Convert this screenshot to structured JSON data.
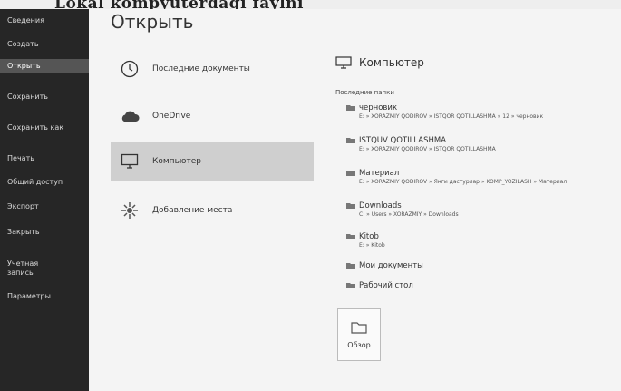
{
  "photo_caption": "Lokal kompyuterdagi faylni",
  "sidebar": {
    "items": [
      {
        "label": "Сведения"
      },
      {
        "label": "Создать"
      },
      {
        "label": "Открыть"
      },
      {
        "label": "Сохранить"
      },
      {
        "label": "Сохранить как"
      },
      {
        "label": "Печать"
      },
      {
        "label": "Общий доступ"
      },
      {
        "label": "Экспорт"
      },
      {
        "label": "Закрыть"
      },
      {
        "label": "Учетная запись"
      },
      {
        "label": "Параметры"
      }
    ]
  },
  "main": {
    "title": "Открыть",
    "places": [
      {
        "label": "Последние документы",
        "icon": "clock-icon"
      },
      {
        "label": "OneDrive",
        "icon": "cloud-icon"
      },
      {
        "label": "Компьютер",
        "icon": "monitor-icon"
      },
      {
        "label": "Добавление места",
        "icon": "add-place-icon"
      }
    ]
  },
  "panel": {
    "title": "Компьютер",
    "recent_heading": "Последние папки",
    "folders": [
      {
        "name": "черновик",
        "path": "E: » XORAZMIY QODIROV » ISTQOR QOTILLASHMA » 12 » черновик"
      },
      {
        "name": "ISTQUV QOTILLASHMA",
        "path": "E: » XORAZMIY QODIROV » ISTQOR QOTILLASHMA"
      },
      {
        "name": "Материал",
        "path": "E: » XORAZMIY QODIROV » Янги дастурлар » KOMP_YOZILASH » Материал"
      },
      {
        "name": "Downloads",
        "path": "C: » Users » XORAZMIY » Downloads"
      },
      {
        "name": "Kitob",
        "path": "E: » Kitob"
      },
      {
        "name": "Мои документы",
        "path": ""
      },
      {
        "name": "Рабочий стол",
        "path": ""
      }
    ],
    "browse_label": "Обзор"
  },
  "colors": {
    "sidebar_bg": "#262626",
    "selected_place": "#cfcfcf"
  }
}
